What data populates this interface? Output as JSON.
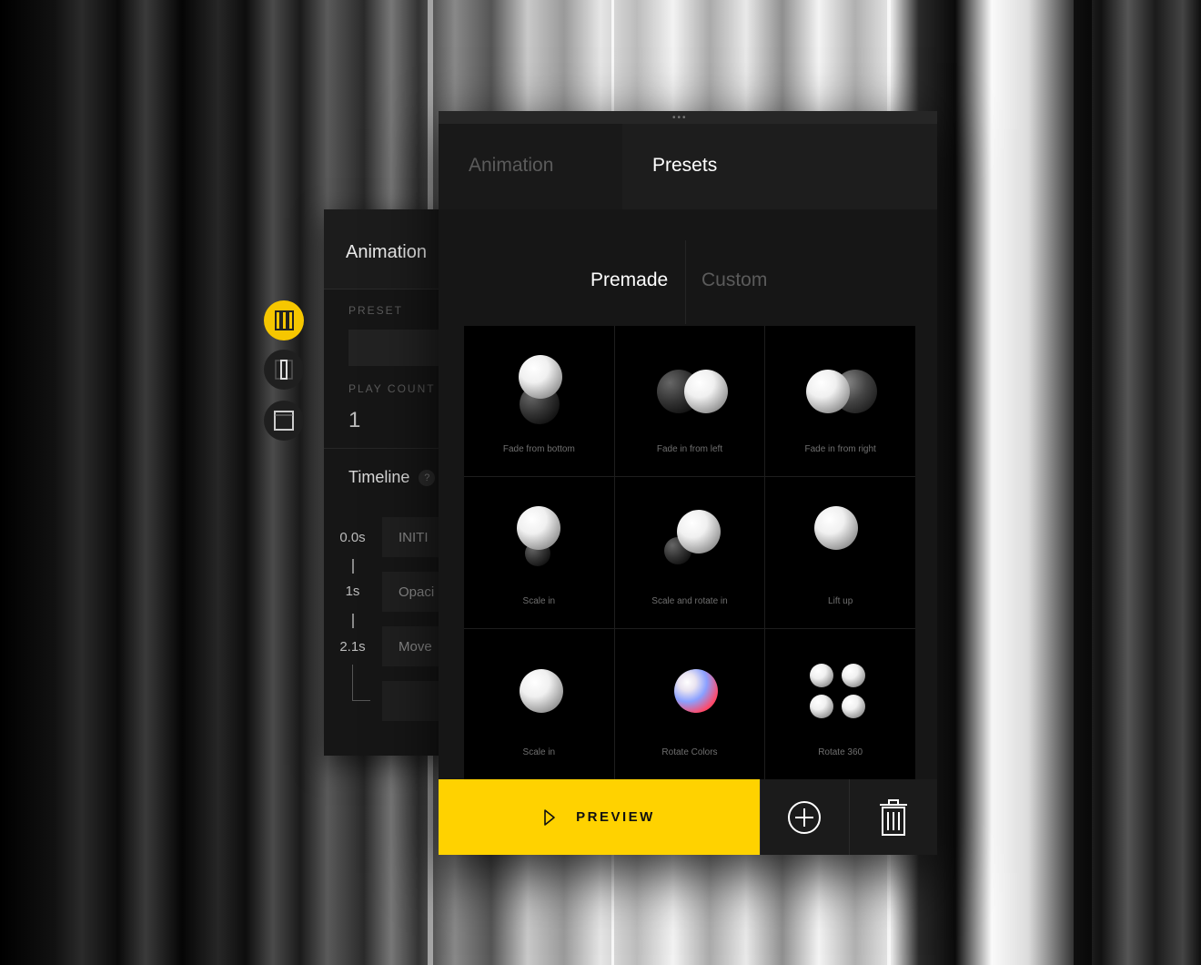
{
  "back_panel": {
    "title": "Animation",
    "preset_label": "PRESET",
    "play_count_label": "PLAY COUNT",
    "play_count_value": "1",
    "timeline_title": "Timeline",
    "help_glyph": "?",
    "timeline": [
      {
        "time": "0.0s",
        "label": "INITI"
      },
      {
        "time": "1s",
        "label": "Opaci"
      },
      {
        "time": "2.1s",
        "label": "Move"
      }
    ]
  },
  "side_toolbar": {
    "buttons": [
      {
        "icon": "three-columns-icon",
        "active": true
      },
      {
        "icon": "single-column-icon",
        "active": false
      },
      {
        "icon": "panel-layout-icon",
        "active": false
      }
    ]
  },
  "main_panel": {
    "handle_dots": "•••",
    "tabs": [
      {
        "label": "Animation",
        "active": false
      },
      {
        "label": "Presets",
        "active": true
      }
    ],
    "subtabs": [
      {
        "label": "Premade",
        "active": true
      },
      {
        "label": "Custom",
        "active": false
      }
    ],
    "presets": [
      {
        "label": "Fade from bottom",
        "icon": "fade-from-bottom-icon"
      },
      {
        "label": "Fade in from left",
        "icon": "fade-in-from-left-icon"
      },
      {
        "label": "Fade in from right",
        "icon": "fade-in-from-right-icon"
      },
      {
        "label": "Scale in",
        "icon": "scale-in-icon"
      },
      {
        "label": "Scale and rotate in",
        "icon": "scale-and-rotate-in-icon"
      },
      {
        "label": "Lift up",
        "icon": "lift-up-icon"
      },
      {
        "label": "Scale in",
        "icon": "scale-in-single-icon"
      },
      {
        "label": "Rotate Colors",
        "icon": "rotate-colors-icon"
      },
      {
        "label": "Rotate 360",
        "icon": "rotate-360-icon"
      }
    ],
    "bottom_bar": {
      "preview_label": "PREVIEW",
      "add_icon": "add-circle-icon",
      "delete_icon": "trash-icon"
    }
  },
  "colors": {
    "accent": "#ffd200",
    "panel_bg": "#161616",
    "text_inactive": "#5b5b5b"
  }
}
